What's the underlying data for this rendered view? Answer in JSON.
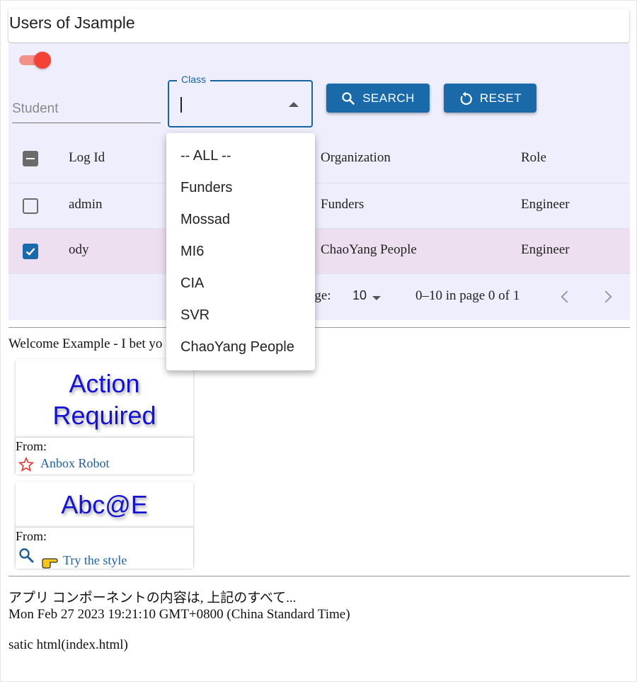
{
  "header": {
    "title": "Users of Jsample"
  },
  "filters": {
    "toggle_on": true,
    "student_placeholder": "Student",
    "class_label": "Class",
    "class_value": "",
    "search_label": "SEARCH",
    "reset_label": "RESET"
  },
  "dropdown": {
    "options": [
      "-- ALL --",
      "Funders",
      "Mossad",
      "MI6",
      "CIA",
      "SVR",
      "ChaoYang People"
    ]
  },
  "table": {
    "columns": {
      "logid": "Log Id",
      "organization": "Organization",
      "role": "Role"
    },
    "rows": [
      {
        "logid": "admin",
        "organization": "Funders",
        "role": "Engineer",
        "selected": false
      },
      {
        "logid": "ody",
        "organization": "ChaoYang People",
        "role": "Engineer",
        "selected": true
      }
    ],
    "header_checkbox": "indeterminate",
    "rows_per_page_label": "age:",
    "rows_per_page": "10",
    "page_info": "0–10 in page 0 of 1"
  },
  "welcome": {
    "text": "Welcome Example - I bet yo"
  },
  "cards": [
    {
      "headline_line1": "Action",
      "headline_line2": "Required",
      "from_label": "From:",
      "link": "Anbox Robot",
      "icon": "star-outline-icon"
    },
    {
      "headline": "Abc@E",
      "from_label": "From:",
      "link": "Try the style",
      "icon": "search-icon",
      "icon2": "pointing-hand-icon"
    }
  ],
  "footer": {
    "jp_text": "アプリ コンポーネントの内容は, 上記のすべて...",
    "date_text": "Mon Feb 27 2023 19:21:10 GMT+0800 (China Standard Time)",
    "static_text": "satic html(index.html)"
  },
  "colors": {
    "primary": "#1a6aaa",
    "toggle": "#f44336",
    "panel_bg": "#eeeefd",
    "selected_row": "#eddff0",
    "headline": "#1414d0"
  }
}
